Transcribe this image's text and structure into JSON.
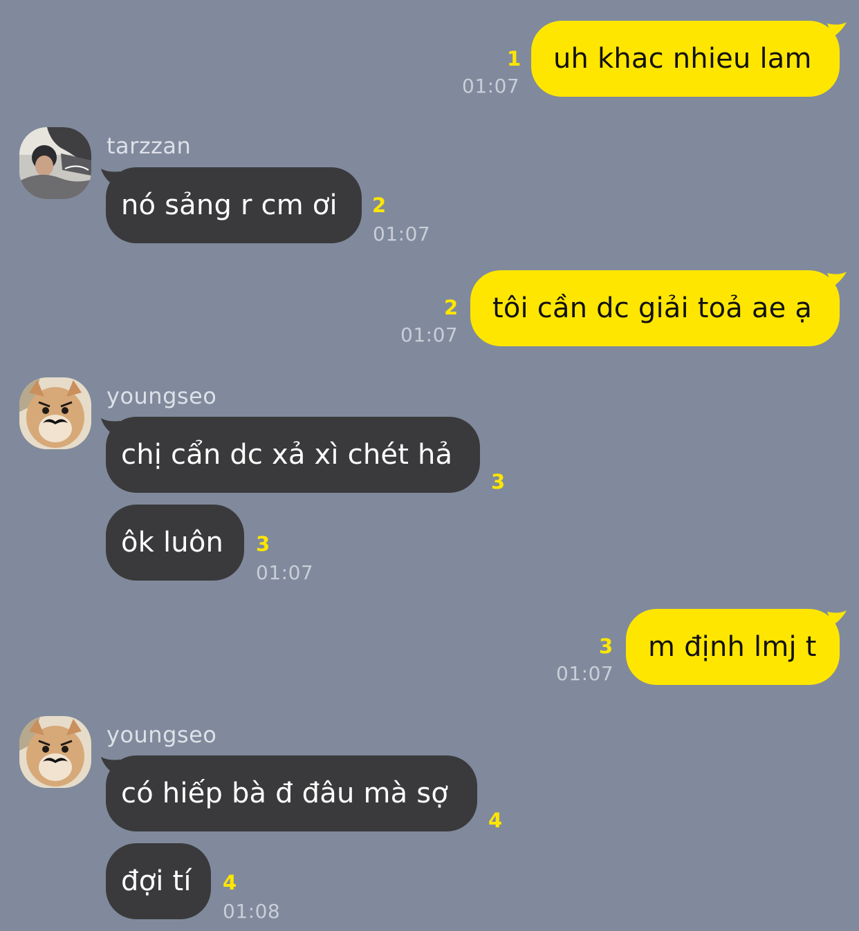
{
  "chat": {
    "messages": [
      {
        "id": "m1",
        "direction": "outgoing",
        "text": "uh khac nhieu lam",
        "unread": "1",
        "time": "01:07"
      },
      {
        "id": "m2",
        "direction": "incoming",
        "sender": "tarzzan",
        "text": "nó sảng r cm ơi",
        "unread": "2",
        "time": "01:07"
      },
      {
        "id": "m3",
        "direction": "outgoing",
        "text": "tôi cần dc giải toả ae ạ",
        "unread": "2",
        "time": "01:07"
      },
      {
        "id": "m4",
        "direction": "incoming",
        "sender": "youngseo",
        "text": "chị cẩn dc xả xì chét hả",
        "unread": "3"
      },
      {
        "id": "m5",
        "direction": "incoming",
        "text": "ôk luôn",
        "unread": "3",
        "time": "01:07"
      },
      {
        "id": "m6",
        "direction": "outgoing",
        "text": "m định lmj t",
        "unread": "3",
        "time": "01:07"
      },
      {
        "id": "m7",
        "direction": "incoming",
        "sender": "youngseo",
        "text": "có hiếp bà đ đâu mà sợ",
        "unread": "4"
      },
      {
        "id": "m8",
        "direction": "incoming",
        "text": "đợi tí",
        "unread": "4",
        "time": "01:08"
      }
    ]
  },
  "colors": {
    "background": "#808a9c",
    "outgoing_bubble": "#ffe600",
    "incoming_bubble": "#3a3a3c",
    "unread_count": "#ffe600",
    "timestamp": "#c9ced8"
  },
  "icons": {
    "avatar_tarzzan": "profile-photo",
    "avatar_youngseo": "cat-with-mustache-photo"
  }
}
